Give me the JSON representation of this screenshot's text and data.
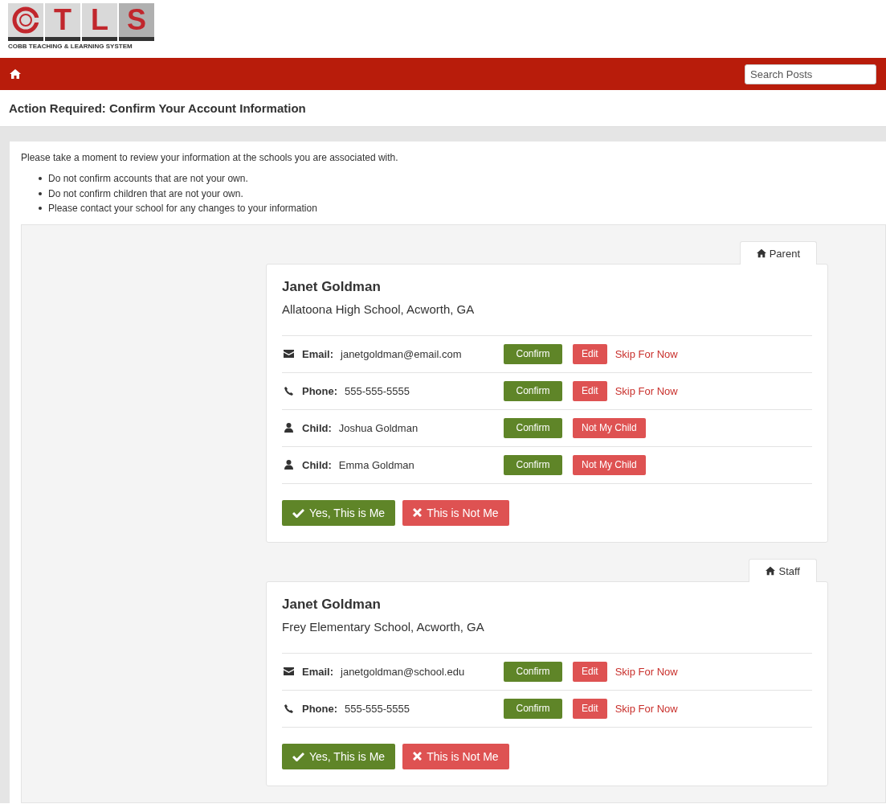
{
  "logo": {
    "letters": [
      "T",
      "L",
      "S"
    ],
    "tagline": "COBB TEACHING & LEARNING SYSTEM"
  },
  "navbar": {
    "search": {
      "placeholder": "Search Posts"
    }
  },
  "page_title": "Action Required: Confirm Your Account Information",
  "intro": "Please take a moment to review your information at the schools you are associated with.",
  "notes": [
    "Do not confirm accounts that are not your own.",
    "Do not confirm children that are not your own.",
    "Please contact your school for any changes to your information"
  ],
  "accounts": [
    {
      "tab": "Parent",
      "name": "Janet Goldman",
      "school": "Allatoona High School, Acworth, GA",
      "rows": [
        {
          "kind": "email",
          "label": "Email:",
          "value": "janetgoldman@email.com",
          "actions": [
            {
              "kind": "confirm",
              "label": "Confirm"
            },
            {
              "kind": "edit",
              "label": "Edit"
            },
            {
              "kind": "skip",
              "label": "Skip For Now"
            }
          ]
        },
        {
          "kind": "phone",
          "label": "Phone:",
          "value": "555-555-5555",
          "actions": [
            {
              "kind": "confirm",
              "label": "Confirm"
            },
            {
              "kind": "edit",
              "label": "Edit"
            },
            {
              "kind": "skip",
              "label": "Skip For Now"
            }
          ]
        },
        {
          "kind": "child",
          "label": "Child:",
          "value": "Joshua Goldman",
          "actions": [
            {
              "kind": "confirm",
              "label": "Confirm"
            },
            {
              "kind": "reject",
              "label": "Not My Child"
            }
          ]
        },
        {
          "kind": "child",
          "label": "Child:",
          "value": "Emma Goldman",
          "actions": [
            {
              "kind": "confirm",
              "label": "Confirm"
            },
            {
              "kind": "reject",
              "label": "Not My Child"
            }
          ]
        }
      ],
      "footer": [
        {
          "kind": "yes",
          "label": "Yes, This is Me"
        },
        {
          "kind": "no",
          "label": "This is Not Me"
        }
      ]
    },
    {
      "tab": "Staff",
      "name": "Janet Goldman",
      "school": "Frey Elementary School, Acworth, GA",
      "rows": [
        {
          "kind": "email",
          "label": "Email:",
          "value": "janetgoldman@school.edu",
          "actions": [
            {
              "kind": "confirm",
              "label": "Confirm"
            },
            {
              "kind": "edit",
              "label": "Edit"
            },
            {
              "kind": "skip",
              "label": "Skip For Now"
            }
          ]
        },
        {
          "kind": "phone",
          "label": "Phone:",
          "value": "555-555-5555",
          "actions": [
            {
              "kind": "confirm",
              "label": "Confirm"
            },
            {
              "kind": "edit",
              "label": "Edit"
            },
            {
              "kind": "skip",
              "label": "Skip For Now"
            }
          ]
        }
      ],
      "footer": [
        {
          "kind": "yes",
          "label": "Yes, This is Me"
        },
        {
          "kind": "no",
          "label": "This is Not Me"
        }
      ]
    }
  ]
}
